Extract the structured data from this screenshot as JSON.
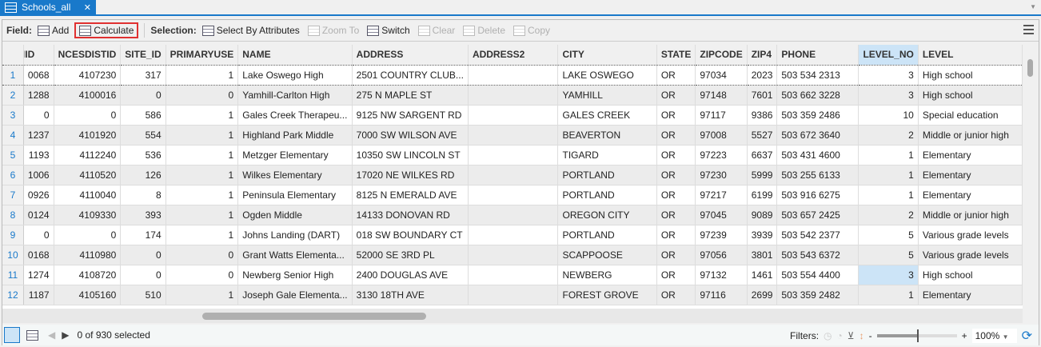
{
  "tab": {
    "title": "Schools_all",
    "close": "✕"
  },
  "toolbar": {
    "field_label": "Field:",
    "add": "Add",
    "calculate": "Calculate",
    "selection_label": "Selection:",
    "select_by_attributes": "Select By Attributes",
    "zoom_to": "Zoom To",
    "switch": "Switch",
    "clear": "Clear",
    "delete": "Delete",
    "copy": "Copy"
  },
  "columns": [
    "IID",
    "NCESDISTID",
    "SITE_ID",
    "PRIMARYUSE",
    "NAME",
    "ADDRESS",
    "ADDRESS2",
    "CITY",
    "STATE",
    "ZIPCODE",
    "ZIP4",
    "PHONE",
    "LEVEL_NO",
    "LEVEL"
  ],
  "rows": [
    [
      "1",
      "0068",
      "4107230",
      "317",
      "1",
      "Lake Oswego High",
      "2501 COUNTRY CLUB...",
      "",
      "LAKE OSWEGO",
      "OR",
      "97034",
      "2023",
      "503 534 2313",
      "3",
      "High school"
    ],
    [
      "2",
      "1288",
      "4100016",
      "0",
      "0",
      "Yamhill-Carlton High",
      "275 N MAPLE ST",
      "",
      "YAMHILL",
      "OR",
      "97148",
      "7601",
      "503 662 3228",
      "3",
      "High school"
    ],
    [
      "3",
      "0",
      "0",
      "586",
      "1",
      "Gales Creek Therapeu...",
      "9125 NW SARGENT RD",
      "",
      "GALES CREEK",
      "OR",
      "97117",
      "9386",
      "503 359 2486",
      "10",
      "Special education"
    ],
    [
      "4",
      "1237",
      "4101920",
      "554",
      "1",
      "Highland Park Middle",
      "7000 SW WILSON AVE",
      "",
      "BEAVERTON",
      "OR",
      "97008",
      "5527",
      "503 672 3640",
      "2",
      "Middle or junior high"
    ],
    [
      "5",
      "1193",
      "4112240",
      "536",
      "1",
      "Metzger Elementary",
      "10350 SW LINCOLN ST",
      "",
      "TIGARD",
      "OR",
      "97223",
      "6637",
      "503 431 4600",
      "1",
      "Elementary"
    ],
    [
      "6",
      "1006",
      "4110520",
      "126",
      "1",
      "Wilkes Elementary",
      "17020 NE WILKES RD",
      "",
      "PORTLAND",
      "OR",
      "97230",
      "5999",
      "503 255 6133",
      "1",
      "Elementary"
    ],
    [
      "7",
      "0926",
      "4110040",
      "8",
      "1",
      "Peninsula Elementary",
      "8125 N EMERALD AVE",
      "",
      "PORTLAND",
      "OR",
      "97217",
      "6199",
      "503 916 6275",
      "1",
      "Elementary"
    ],
    [
      "8",
      "0124",
      "4109330",
      "393",
      "1",
      "Ogden Middle",
      "14133 DONOVAN RD",
      "",
      "OREGON CITY",
      "OR",
      "97045",
      "9089",
      "503 657 2425",
      "2",
      "Middle or junior high"
    ],
    [
      "9",
      "0",
      "0",
      "174",
      "1",
      "Johns Landing (DART)",
      "018 SW BOUNDARY CT",
      "",
      "PORTLAND",
      "OR",
      "97239",
      "3939",
      "503 542 2377",
      "5",
      "Various grade levels"
    ],
    [
      "10",
      "0168",
      "4110980",
      "0",
      "0",
      "Grant Watts Elementa...",
      "52000 SE 3RD PL",
      "",
      "SCAPPOOSE",
      "OR",
      "97056",
      "3801",
      "503 543 6372",
      "5",
      "Various grade levels"
    ],
    [
      "11",
      "1274",
      "4108720",
      "0",
      "0",
      "Newberg Senior High",
      "2400 DOUGLAS AVE",
      "",
      "NEWBERG",
      "OR",
      "97132",
      "1461",
      "503 554 4400",
      "3",
      "High school"
    ],
    [
      "12",
      "1187",
      "4105160",
      "510",
      "1",
      "Joseph Gale Elementa...",
      "3130 18TH AVE",
      "",
      "FOREST GROVE",
      "OR",
      "97116",
      "2699",
      "503 359 2482",
      "1",
      "Elementary"
    ]
  ],
  "status": {
    "selected": "0 of 930 selected",
    "filters": "Filters:",
    "zoom": "100%"
  }
}
